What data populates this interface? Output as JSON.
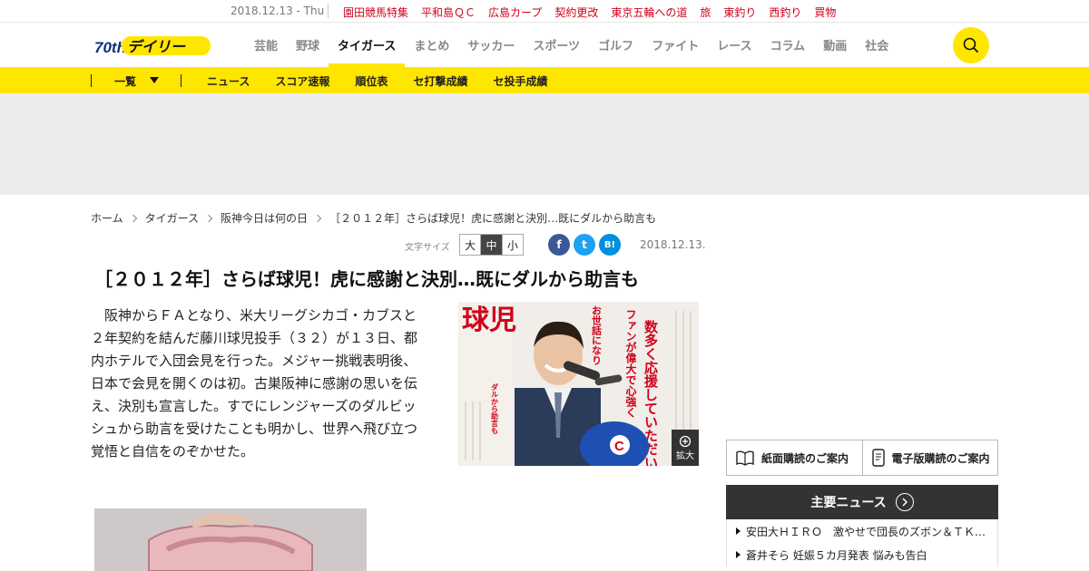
{
  "topbar": {
    "date": "2018.12.13 - Thu",
    "links": [
      "園田競馬特集",
      "平和島ＱＣ",
      "広島カープ",
      "契約更改",
      "東京五輪への道",
      "旅",
      "東釣り",
      "西釣り",
      "買物"
    ]
  },
  "header": {
    "logo_text": "デイリー",
    "logo_badge": "70th",
    "nav": [
      "芸能",
      "野球",
      "タイガース",
      "まとめ",
      "サッカー",
      "スポーツ",
      "ゴルフ",
      "ファイト",
      "レース",
      "コラム",
      "動画",
      "社会"
    ],
    "active_nav": "タイガース",
    "search_icon": "search-icon"
  },
  "subnav": {
    "list_label": "一覧",
    "links": [
      "ニュース",
      "スコア速報",
      "順位表",
      "セ打撃成績",
      "セ投手成績"
    ]
  },
  "breadcrumb": [
    "ホーム",
    "タイガース",
    "阪神今日は何の日",
    "［２０１２年］さらば球児！虎に感謝と決別…既にダルから助言も"
  ],
  "tools": {
    "font_size_label": "文字サイズ",
    "sizes": [
      "大",
      "中",
      "小"
    ],
    "selected_size": "中",
    "share": [
      {
        "name": "facebook-icon",
        "glyph": "f",
        "color": "#3b5998"
      },
      {
        "name": "twitter-icon",
        "glyph": "t",
        "color": "#1da1f2"
      },
      {
        "name": "hatena-icon",
        "glyph": "B!",
        "color": "#008fde"
      }
    ],
    "date": "2018.12.13."
  },
  "article": {
    "title": "［２０１２年］さらば球児！虎に感謝と決別…既にダルから助言も",
    "body": "阪神からＦＡとなり、米大リーグシカゴ・カブスと２年契約を結んだ藤川球児投手（３２）が１３日、都内ホテルで入団会見を行った。メジャー挑戦表明後、日本で会見を開くのは初。古巣阪神に感謝の思いを伝え、決別も宣言した。すでにレンジャーズのダルビッシュから助言を受けたことも明かし、世界へ飛び立つ覚悟と自信をのぞかせた。",
    "expand_label": "拡大",
    "photo_headlines": [
      "球児",
      "数多く応援していただいた",
      "ファンが偉大で心強く",
      "お世話になり",
      "ダルから助言も"
    ]
  },
  "sidebar": {
    "subscriptions": [
      "紙面購読のご案内",
      "電子版購読のご案内"
    ],
    "main_news_label": "主要ニュース",
    "news": [
      "安田大ＨＩＲＯ　激やせで団長のズボン＆ＴＫＯ木下の服がブカブカ",
      "蒼井そら 妊娠５カ月発表 悩みも告白"
    ]
  },
  "colors": {
    "accent_yellow": "#ffe600",
    "topbar_red": "#d0021b",
    "dark": "#333333"
  }
}
